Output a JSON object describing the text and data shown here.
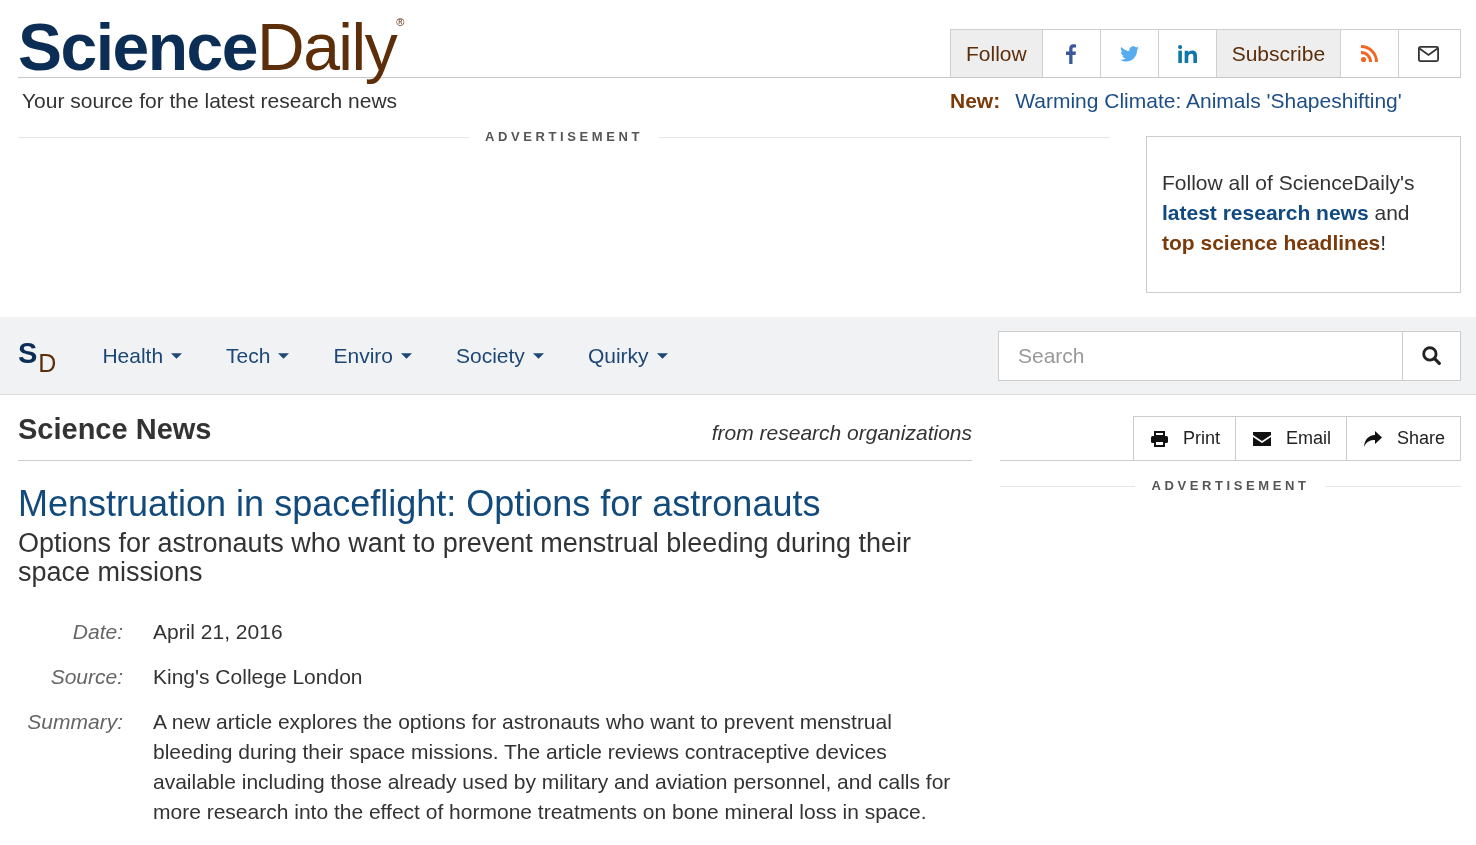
{
  "header": {
    "logo": {
      "first": "Science",
      "second": "Daily",
      "mark": "®"
    },
    "social_bar": {
      "follow_label": "Follow",
      "subscribe_label": "Subscribe"
    },
    "tagline": "Your source for the latest research news",
    "news_flash": {
      "label": "New:",
      "headline": "Warming Climate: Animals 'Shapeshifting'"
    }
  },
  "top_ad": {
    "label": "ADVERTISEMENT"
  },
  "promo_box": {
    "parts": [
      {
        "kind": "text",
        "text": "Follow all of ScienceDaily's "
      },
      {
        "kind": "news-link",
        "text": "latest research news"
      },
      {
        "kind": "text",
        "text": " and "
      },
      {
        "kind": "headline-link",
        "text": "top science headlines"
      },
      {
        "kind": "text",
        "text": "!"
      }
    ]
  },
  "nav": {
    "logo": {
      "first": "S",
      "second": "D"
    },
    "items": [
      {
        "label": "Health"
      },
      {
        "label": "Tech"
      },
      {
        "label": "Enviro"
      },
      {
        "label": "Society"
      },
      {
        "label": "Quirky"
      }
    ],
    "search": {
      "placeholder": "Search"
    }
  },
  "section": {
    "title": "Science News",
    "note": "from research organizations"
  },
  "tools": [
    {
      "kind": "print",
      "label": "Print"
    },
    {
      "kind": "email",
      "label": "Email"
    },
    {
      "kind": "share",
      "label": "Share"
    }
  ],
  "side_ad": {
    "label": "ADVERTISEMENT"
  },
  "article": {
    "title": "Menstruation in spaceflight: Options for astronauts",
    "subtitle": "Options for astronauts who want to prevent menstrual bleeding during their space missions",
    "meta": [
      {
        "label": "Date:",
        "value": "April 21, 2016"
      },
      {
        "label": "Source:",
        "value": "King's College London"
      },
      {
        "label": "Summary:",
        "value": "A new article explores the options for astronauts who want to prevent menstrual bleeding during their space missions. The article reviews contraceptive devices available including those already used by military and aviation personnel, and calls for more research into the effect of hormone treatments on bone mineral loss in space."
      }
    ]
  }
}
